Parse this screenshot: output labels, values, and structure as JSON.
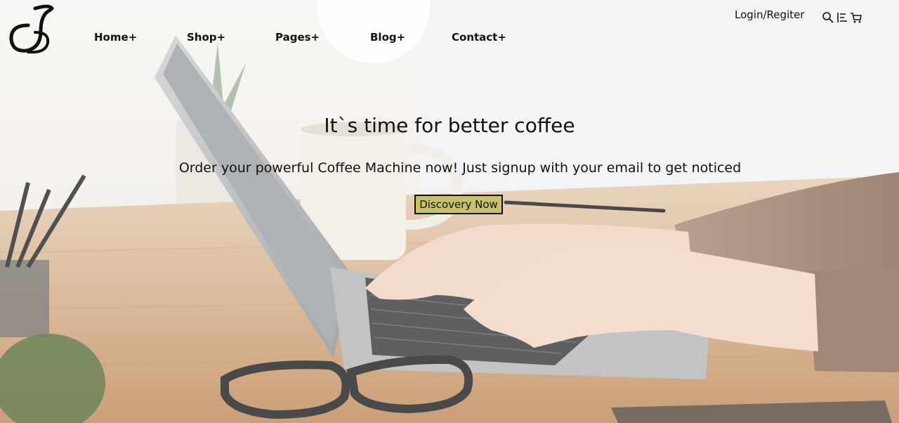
{
  "header": {
    "logo_alt": "logo",
    "nav": [
      {
        "label": "Home+"
      },
      {
        "label": "Shop+"
      },
      {
        "label": "Pages+"
      },
      {
        "label": "Blog+"
      },
      {
        "label": "Contact+"
      }
    ],
    "login_label": "Login/Regiter",
    "icons": [
      "search-icon",
      "filter-icon",
      "cart-icon"
    ]
  },
  "hero": {
    "title": "It`s time for better coffee",
    "subtitle": "Order your powerful Coffee Machine now! Just signup with your email to get noticed",
    "cta_label": "Discovery Now"
  },
  "colors": {
    "cta_background": "#c7c169",
    "text": "#111111",
    "desk_wood": "#c89a6b",
    "sleeve": "#8a6a55"
  }
}
